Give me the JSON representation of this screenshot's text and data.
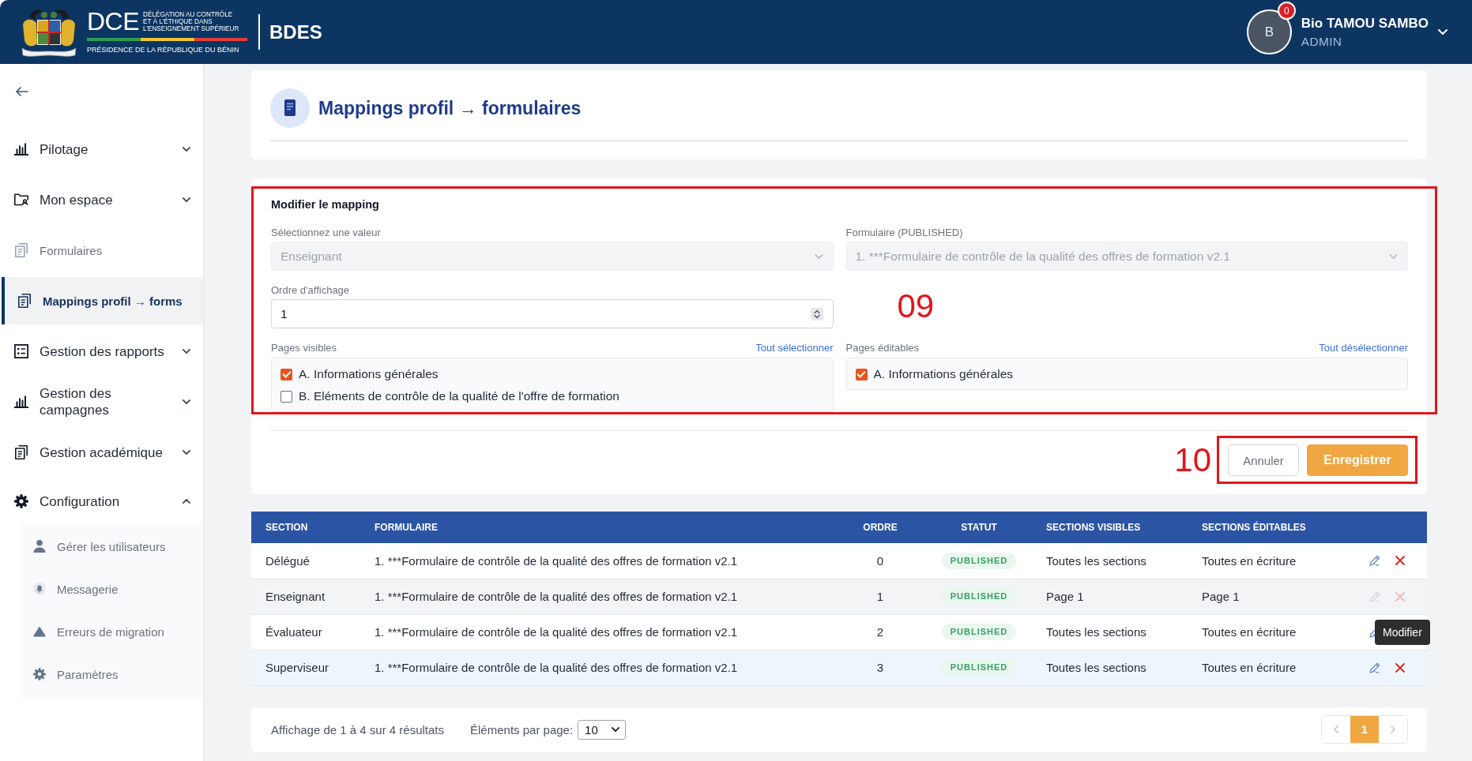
{
  "header": {
    "logo": {
      "acronym": "DCE",
      "lines": [
        "DÉLÉGATION AU CONTRÔLE",
        "ET À L’ÉTHIQUE DANS",
        "L’ENSEIGNEMENT SUPÉRIEUR"
      ],
      "subtitle": "PRÉSIDENCE DE LA RÉPUBLIQUE DU BÉNIN"
    },
    "app_name": "BDES",
    "user": {
      "initial": "B",
      "notifications": "0",
      "name": "Bio TAMOU SAMBO",
      "role": "ADMIN"
    }
  },
  "sidebar": {
    "items": [
      {
        "kind": "group",
        "label": "Pilotage",
        "selected": false,
        "expanded": false
      },
      {
        "kind": "group",
        "label": "Mon espace",
        "selected": false,
        "expanded": false
      },
      {
        "kind": "link",
        "label": "Formulaires",
        "selected": false
      },
      {
        "kind": "link",
        "label": "Mappings profil → forms",
        "selected": true
      },
      {
        "kind": "group",
        "label": "Gestion des rapports",
        "selected": false,
        "expanded": false
      },
      {
        "kind": "group",
        "label": "Gestion des campagnes",
        "selected": false,
        "expanded": false
      },
      {
        "kind": "group",
        "label": "Gestion académique",
        "selected": false,
        "expanded": false
      },
      {
        "kind": "group",
        "label": "Configuration",
        "selected": false,
        "expanded": true,
        "children": [
          {
            "label": "Gérer les utilisateurs",
            "selected": false
          },
          {
            "label": "Messagerie",
            "selected": false
          },
          {
            "label": "Erreurs de migration",
            "selected": false
          },
          {
            "label": "Paramètres",
            "selected": false
          }
        ]
      }
    ]
  },
  "page": {
    "title": "Mappings profil → formulaires"
  },
  "form": {
    "title": "Modifier le mapping",
    "fields": [
      {
        "kind": "select",
        "label": "Sélectionnez une valeur",
        "value": "Enseignant",
        "disabled": true
      },
      {
        "kind": "select",
        "label": "Formulaire (PUBLISHED)",
        "value": "1. ***Formulaire de contrôle de la qualité des offres de formation v2.1",
        "disabled": true
      },
      {
        "kind": "number",
        "label": "Ordre d'affichage",
        "value": "1",
        "disabled": false
      }
    ],
    "page_lists": [
      {
        "label": "Pages visibles",
        "action": "Tout sélectionner",
        "items": [
          {
            "label": "A. Informations générales",
            "checked": true
          },
          {
            "label": "B. Eléments de contrôle de la qualité de l'offre de formation",
            "checked": false
          }
        ]
      },
      {
        "label": "Pages éditables",
        "action": "Tout désélectionner",
        "items": [
          {
            "label": "A. Informations générales",
            "checked": true
          }
        ]
      }
    ],
    "buttons": [
      {
        "kind": "secondary",
        "label": "Annuler"
      },
      {
        "kind": "primary",
        "label": "Enregistrer"
      }
    ],
    "annotations": [
      {
        "label": "09"
      },
      {
        "label": "10"
      }
    ]
  },
  "table": {
    "columns": [
      "SECTION",
      "FORMULAIRE",
      "ORDRE",
      "STATUT",
      "SECTIONS VISIBLES",
      "SECTIONS ÉDITABLES"
    ],
    "rows": [
      {
        "section": "Délégué",
        "form": "1. ***Formulaire de contrôle de la qualité des offres de formation v2.1",
        "order": "0",
        "status": "PUBLISHED",
        "visible": "Toutes les sections",
        "editable": "Toutes en écriture",
        "editing": false,
        "hovered": false
      },
      {
        "section": "Enseignant",
        "form": "1. ***Formulaire de contrôle de la qualité des offres de formation v2.1",
        "order": "1",
        "status": "PUBLISHED",
        "visible": "Page 1",
        "editable": "Page 1",
        "editing": true,
        "hovered": false
      },
      {
        "section": "Évaluateur",
        "form": "1. ***Formulaire de contrôle de la qualité des offres de formation v2.1",
        "order": "2",
        "status": "PUBLISHED",
        "visible": "Toutes les sections",
        "editable": "Toutes en écriture",
        "editing": false,
        "hovered": false,
        "tooltip": "Modifier"
      },
      {
        "section": "Superviseur",
        "form": "1. ***Formulaire de contrôle de la qualité des offres de formation v2.1",
        "order": "3",
        "status": "PUBLISHED",
        "visible": "Toutes les sections",
        "editable": "Toutes en écriture",
        "editing": false,
        "hovered": true
      }
    ]
  },
  "pagination": {
    "summary": "Affichage de 1 à 4 sur 4 résultats",
    "per_page_label": "Éléments par page:",
    "per_page": "10",
    "previous": {
      "disabled": true
    },
    "pages": [
      {
        "label": "1",
        "selected": true
      }
    ],
    "next": {
      "disabled": true
    }
  }
}
